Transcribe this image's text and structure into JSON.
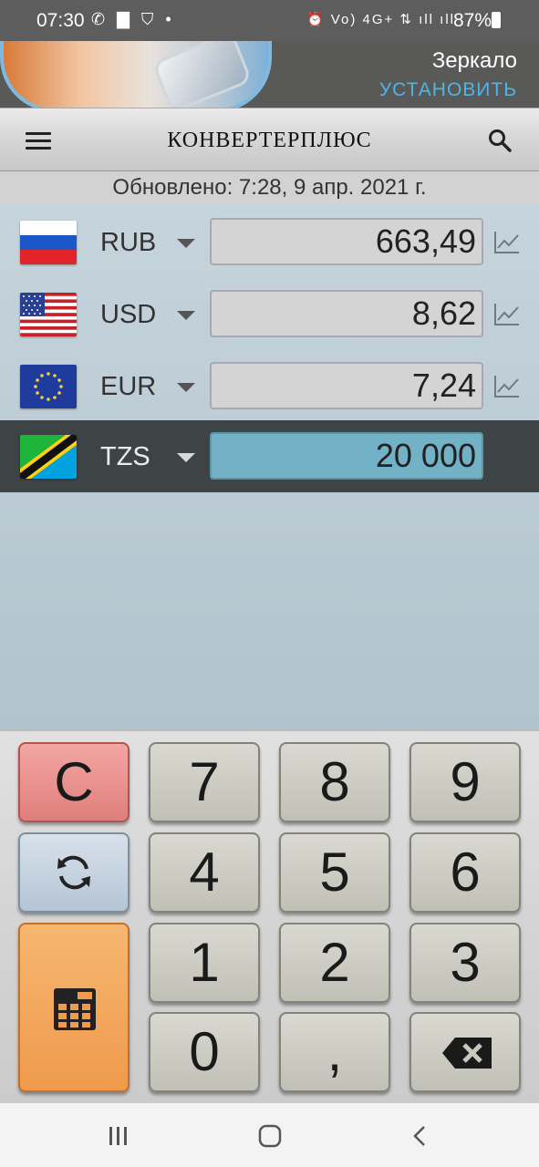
{
  "status_bar": {
    "time": "07:30",
    "left_icons": "✆ ▇ ⛉ •",
    "right_icons": "⏰ Vo) 4G+ ⇅ ıll ıll",
    "battery": "87%"
  },
  "ad": {
    "title": "Зеркало",
    "cta": "УСТАНОВИТЬ"
  },
  "toolbar": {
    "title": "КОНВЕРТЕРПЛЮС",
    "menu_icon": "hamburger-menu-icon",
    "search_icon": "search-icon"
  },
  "updated_text": "Обновлено: 7:28, 9 апр. 2021 г.",
  "currencies": [
    {
      "code": "RUB",
      "value": "663,49",
      "flag": "russia"
    },
    {
      "code": "USD",
      "value": "8,62",
      "flag": "usa"
    },
    {
      "code": "EUR",
      "value": "7,24",
      "flag": "eu"
    },
    {
      "code": "TZS",
      "value": "20 000",
      "flag": "tanzania",
      "selected": true
    }
  ],
  "keypad": {
    "clear": "C",
    "k7": "7",
    "k8": "8",
    "k9": "9",
    "k4": "4",
    "k5": "5",
    "k6": "6",
    "k1": "1",
    "k2": "2",
    "k3": "3",
    "k0": "0",
    "comma": ",",
    "refresh_icon": "refresh-icon",
    "calculator_icon": "calculator-icon",
    "backspace_icon": "backspace-icon"
  },
  "colors": {
    "selected_row": "#3e4345",
    "selected_field": "#73b1c6",
    "clear_key": "#df7f7c",
    "calc_key": "#ef9a4c",
    "ad_cta": "#4fb4e6"
  }
}
